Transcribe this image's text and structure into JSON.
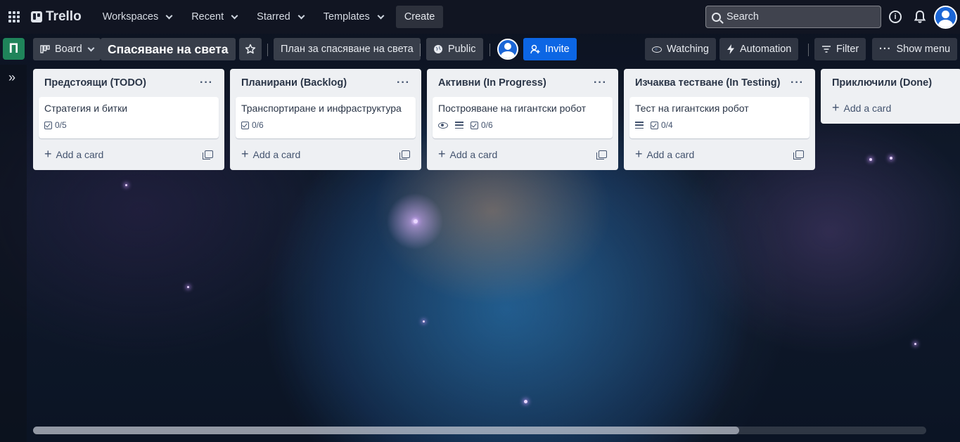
{
  "header": {
    "logo_text": "Trello",
    "nav": [
      "Workspaces",
      "Recent",
      "Starred",
      "Templates"
    ],
    "create_label": "Create",
    "search_placeholder": "Search"
  },
  "board_header": {
    "workspace_initial": "П",
    "view_label": "Board",
    "board_title": "Спасяване на света",
    "workspace_name": "План за спасяване на света",
    "visibility_label": "Public",
    "invite_label": "Invite",
    "watching_label": "Watching",
    "automation_label": "Automation",
    "filter_label": "Filter",
    "show_menu_label": "Show menu"
  },
  "lists": [
    {
      "title": "Предстоящи (TODO)",
      "cards": [
        {
          "title": "Стратегия и битки",
          "checklist": "0/5",
          "watch": false,
          "description": false
        }
      ],
      "add_label": "Add a card"
    },
    {
      "title": "Планирани (Backlog)",
      "cards": [
        {
          "title": "Транспортиране и инфраструктура",
          "checklist": "0/6",
          "watch": false,
          "description": false
        }
      ],
      "add_label": "Add a card"
    },
    {
      "title": "Активни (In Progress)",
      "cards": [
        {
          "title": "Построяване на гигантски робот",
          "checklist": "0/6",
          "watch": true,
          "description": true
        }
      ],
      "add_label": "Add a card"
    },
    {
      "title": "Изчаква тестване (In Testing)",
      "cards": [
        {
          "title": "Тест на гигантския робот",
          "checklist": "0/4",
          "watch": false,
          "description": true
        }
      ],
      "add_label": "Add a card"
    },
    {
      "title": "Приключили (Done)",
      "cards": [],
      "add_label": "Add a card"
    }
  ],
  "colors": {
    "workspace_badge": "#1f845a",
    "invite": "#0c66e4",
    "list_bg": "#eef0f3"
  }
}
